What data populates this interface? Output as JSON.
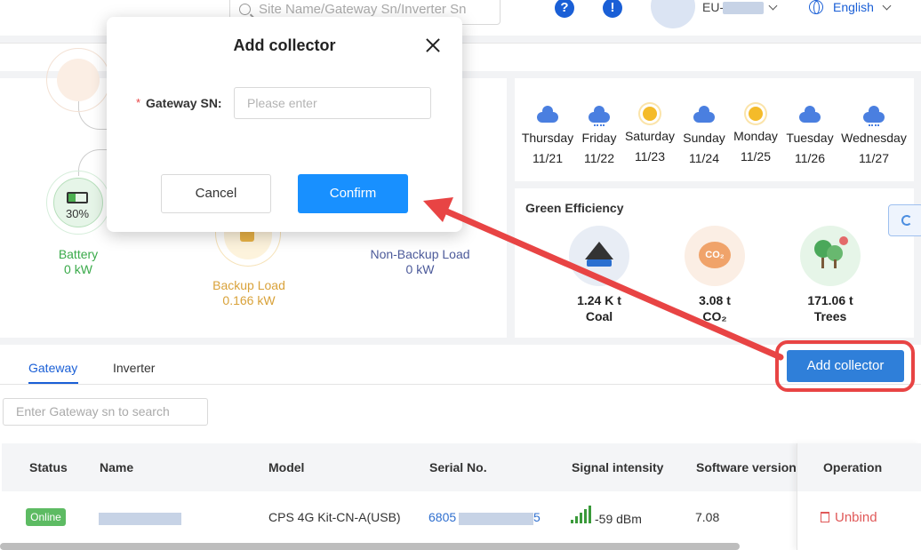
{
  "header": {
    "search_placeholder": "Site Name/Gateway Sn/Inverter Sn",
    "help_icon": "question-circle-icon",
    "alert_icon": "exclamation-circle-icon",
    "account_prefix": "EU-",
    "language": "English"
  },
  "flow": {
    "battery": {
      "percent": "30%",
      "label": "Battery",
      "power": "0 kW"
    },
    "backup_load": {
      "label": "Backup Load",
      "power": "0.166 kW"
    },
    "non_backup_load": {
      "label": "Non-Backup Load",
      "power": "0 kW"
    }
  },
  "weather": [
    {
      "day": "Thursday",
      "date": "11/21",
      "icon": "cloud"
    },
    {
      "day": "Friday",
      "date": "11/22",
      "icon": "cloud-rain"
    },
    {
      "day": "Saturday",
      "date": "11/23",
      "icon": "sun"
    },
    {
      "day": "Sunday",
      "date": "11/24",
      "icon": "cloud"
    },
    {
      "day": "Monday",
      "date": "11/25",
      "icon": "sun"
    },
    {
      "day": "Tuesday",
      "date": "11/26",
      "icon": "cloud"
    },
    {
      "day": "Wednesday",
      "date": "11/27",
      "icon": "sun-cloud-rain"
    }
  ],
  "green": {
    "title": "Green Efficiency",
    "items": [
      {
        "value": "1.24 K t",
        "label": "Coal",
        "icon": "coal-icon"
      },
      {
        "value": "3.08 t",
        "label": "CO₂",
        "icon": "co2-icon"
      },
      {
        "value": "171.06 t",
        "label": "Trees",
        "icon": "trees-icon"
      }
    ]
  },
  "tabs": [
    {
      "label": "Gateway",
      "active": true
    },
    {
      "label": "Inverter",
      "active": false
    }
  ],
  "add_collector_label": "Add collector",
  "gateway_search_placeholder": "Enter Gateway sn to search",
  "table": {
    "columns": [
      "Status",
      "Name",
      "Model",
      "Serial No.",
      "Signal intensity",
      "Software version",
      "Operation"
    ],
    "rows": [
      {
        "status": "Online",
        "name": "",
        "model": "CPS 4G Kit-CN-A(USB)",
        "serial_prefix": "6805",
        "serial_suffix": "5",
        "signal": "-59 dBm",
        "software_version": "7.08",
        "operation": "Unbind"
      }
    ]
  },
  "modal": {
    "title": "Add collector",
    "required_mark": "*",
    "field_label": "Gateway SN:",
    "field_placeholder": "Please enter",
    "field_value": "",
    "cancel_label": "Cancel",
    "confirm_label": "Confirm"
  },
  "colors": {
    "primary": "#1890ff",
    "brand_blue": "#1a5fd6",
    "annotation_red": "#e84444",
    "online_green": "#5dbb63",
    "danger": "#e05858"
  }
}
